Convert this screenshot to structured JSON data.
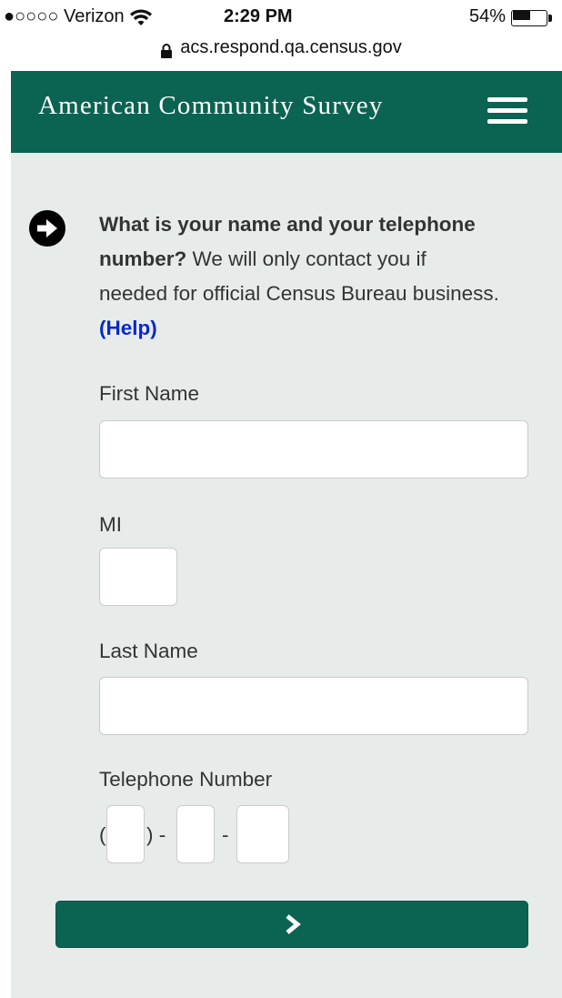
{
  "status_bar": {
    "carrier": "●○○○○ Verizon",
    "time": "2:29 PM",
    "battery_percent_label": "54%",
    "battery_level": 0.54
  },
  "url_bar": {
    "url": "acs.respond.qa.census.gov",
    "icon": "lock-icon"
  },
  "header": {
    "title": "American Community Survey",
    "menu_icon": "hamburger-menu-icon",
    "background_color": "#0b6351"
  },
  "question": {
    "icon": "arrow-right-circle-icon",
    "bold_text": "What is your name and your telephone number?",
    "body_text": " We will only contact you if needed for official Census Bureau business. ",
    "help_link": "(Help)",
    "help_link_color": "#0a28c9"
  },
  "form": {
    "first_name": {
      "label": "First Name",
      "value": ""
    },
    "middle_initial": {
      "label": "MI",
      "value": ""
    },
    "last_name": {
      "label": "Last Name",
      "value": ""
    },
    "telephone": {
      "label": "Telephone Number",
      "open_paren": "(",
      "close_paren_dash": ") -",
      "dash": "-",
      "area_code": "",
      "prefix": "",
      "line_number": ""
    }
  },
  "next_button": {
    "icon": "chevron-right-icon",
    "background_color": "#0b6351"
  },
  "colors": {
    "content_background": "#e7ecea",
    "brand_green": "#0b6351"
  }
}
